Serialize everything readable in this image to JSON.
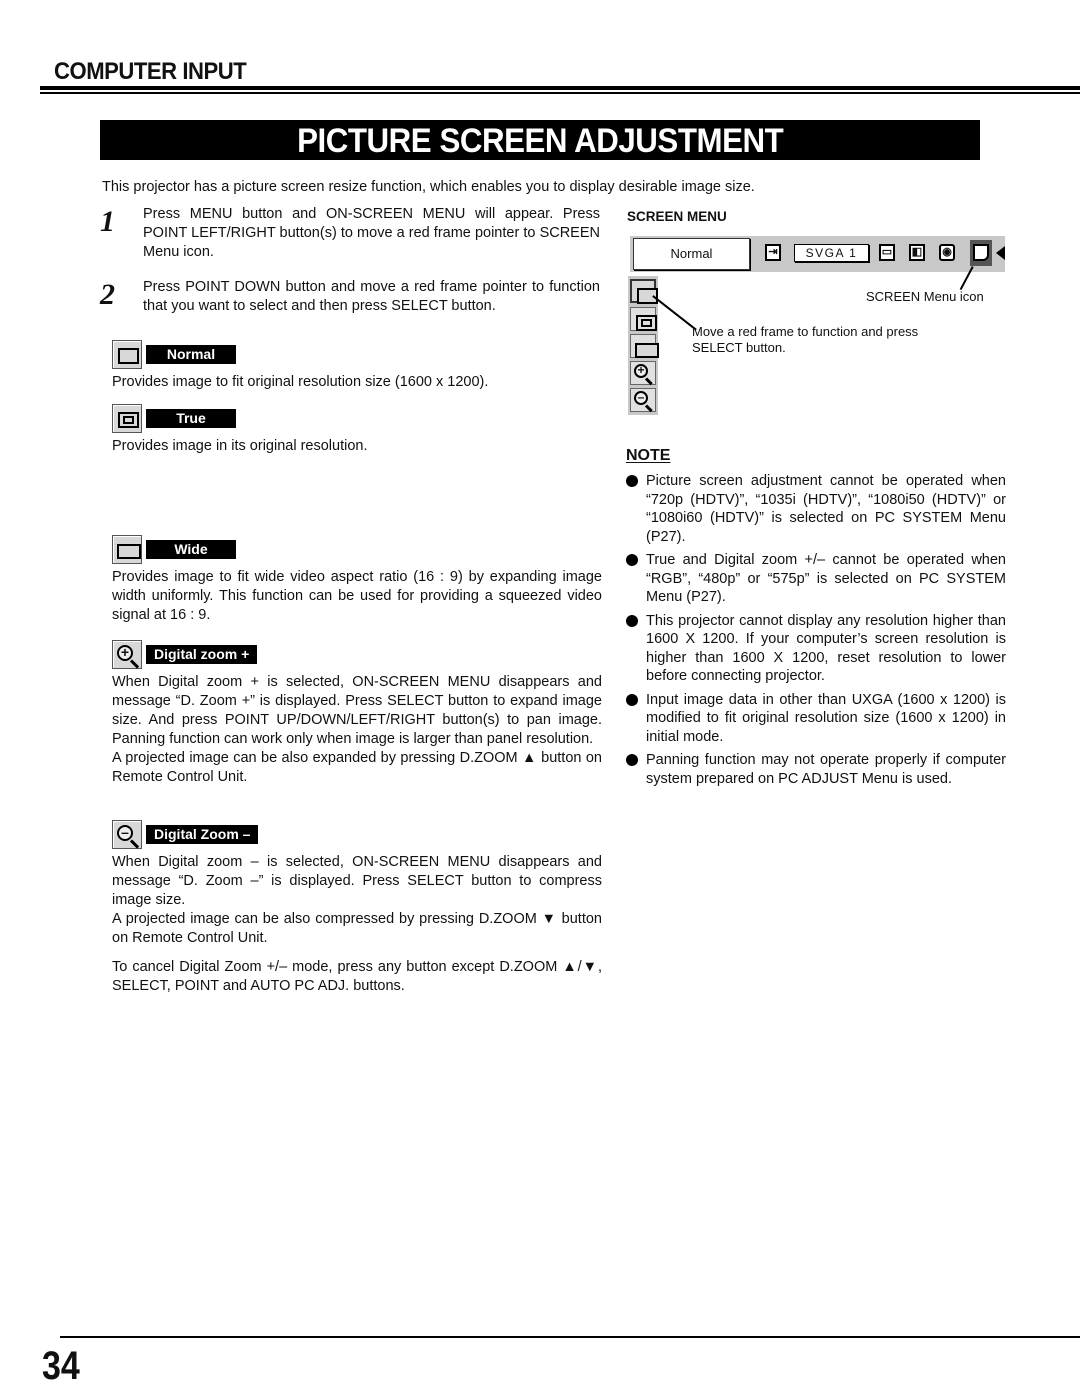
{
  "header": {
    "section": "COMPUTER INPUT",
    "title": "PICTURE SCREEN ADJUSTMENT"
  },
  "intro": "This projector has a picture screen resize function, which enables you to display desirable image size.",
  "steps": [
    {
      "number": "1",
      "text": "Press MENU button and ON-SCREEN MENU will appear.  Press POINT LEFT/RIGHT button(s) to move a red frame pointer to SCREEN Menu icon."
    },
    {
      "number": "2",
      "text": "Press POINT DOWN button and move a red frame pointer to function that you want to select and then press SELECT button."
    }
  ],
  "options": [
    {
      "icon": "normal-screen-icon",
      "label": "Normal",
      "text": "Provides image to fit original resolution size (1600 x 1200)."
    },
    {
      "icon": "true-screen-icon",
      "label": "True",
      "text": "Provides image in its original resolution."
    },
    {
      "icon": "wide-screen-icon",
      "label": "Wide",
      "text": "Provides image to fit wide video aspect ratio (16 : 9) by expanding image width uniformly.  This function can be used for providing a squeezed video signal at 16 : 9."
    },
    {
      "icon": "zoom-in-icon",
      "label": "Digital zoom +",
      "text": "When Digital zoom + is selected, ON-SCREEN MENU disappears and message “D. Zoom +” is displayed.  Press SELECT button to expand image size.  And press POINT UP/DOWN/LEFT/RIGHT button(s) to pan image.  Panning function can work only when image is larger than panel resolution.",
      "text2": "A projected image can be also expanded by pressing D.ZOOM ▲ button on Remote Control Unit."
    },
    {
      "icon": "zoom-out-icon",
      "label": "Digital Zoom –",
      "text": "When Digital zoom – is selected, ON-SCREEN MENU disappears and message “D. Zoom –” is displayed.  Press SELECT button to compress image size.",
      "text2": "A projected image can be also compressed by pressing D.ZOOM ▼ button on Remote Control Unit."
    }
  ],
  "cancel_note": "To cancel Digital Zoom +/– mode, press any button except D.ZOOM ▲/▼, SELECT, POINT and AUTO PC ADJ. buttons.",
  "screen_menu": {
    "title": "SCREEN MENU",
    "current_mode": "Normal",
    "source": "SVGA 1",
    "callout_icon": "SCREEN Menu icon",
    "callout_function": "Move a red frame to function and press SELECT button."
  },
  "note": {
    "title": "NOTE",
    "items": [
      "Picture screen adjustment cannot be operated when “720p (HDTV)”, “1035i (HDTV)”, “1080i50 (HDTV)” or “1080i60 (HDTV)” is selected on PC SYSTEM Menu  (P27).",
      "True and Digital zoom +/– cannot be operated when “RGB”, “480p” or “575p” is selected on PC SYSTEM Menu  (P27).",
      "This projector cannot display any resolution higher than 1600 X 1200.  If your computer’s screen resolution is higher than 1600 X 1200, reset resolution to lower before connecting projector.",
      "Input image data in other than UXGA (1600 x 1200) is modified to fit original resolution size (1600 x 1200) in initial mode.",
      "Panning function may not operate properly if computer system prepared on PC ADJUST Menu is used."
    ]
  },
  "page_number": "34"
}
